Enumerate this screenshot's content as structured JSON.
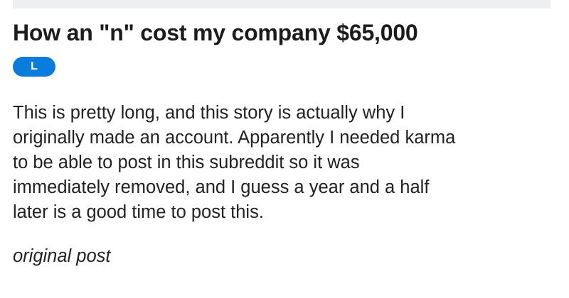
{
  "post": {
    "title": "How an \"n\" cost my company $65,000",
    "flair": "L",
    "body_lines": [
      "This is pretty long, and this story is actually why I",
      "originally made an account. Apparently I needed karma",
      "to be able to post in this subreddit so it was",
      "immediately removed, and I guess a year and a half",
      "later is a good time to post this."
    ],
    "link_label": "original post"
  },
  "colors": {
    "flair_background": "#0a7ddc",
    "text": "#222222",
    "top_strip": "#eeeff1"
  }
}
